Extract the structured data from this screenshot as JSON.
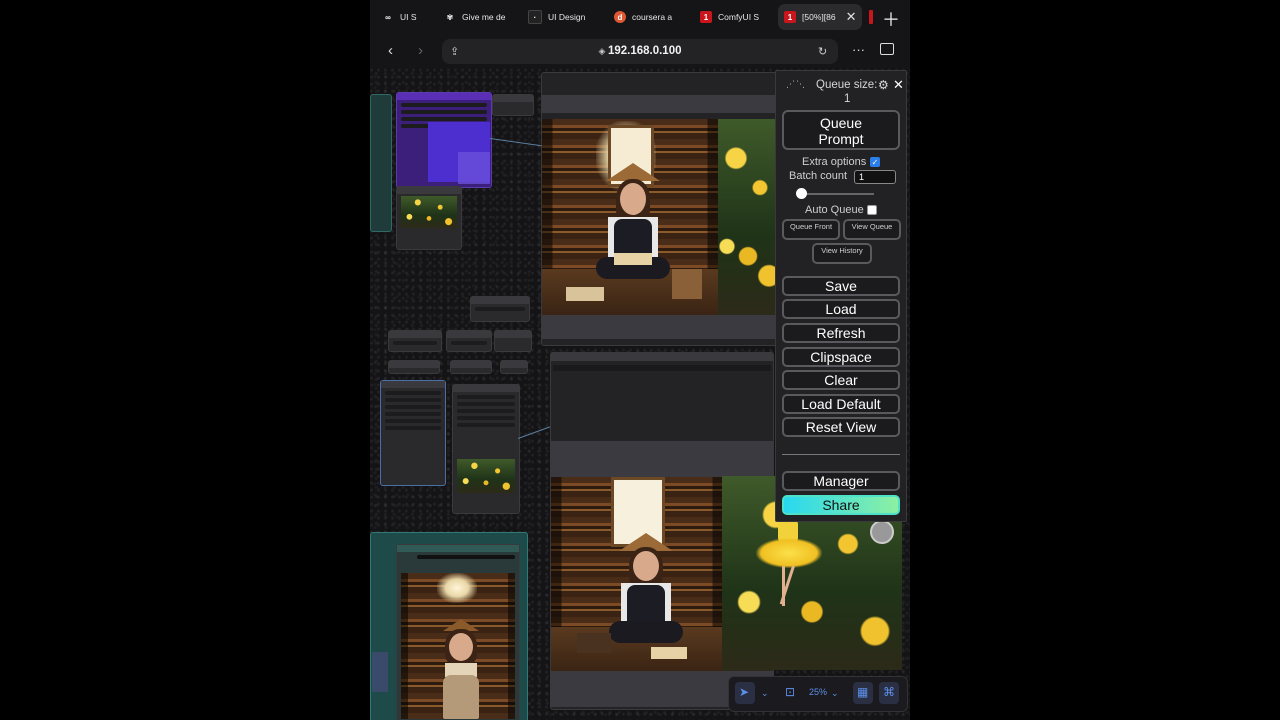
{
  "browser": {
    "tabs": [
      {
        "label": "UI S",
        "icon": "infinity-icon",
        "color": "#ffffff"
      },
      {
        "label": "Give me de",
        "icon": "openai-icon",
        "color": "#ffffff"
      },
      {
        "label": "UI Design",
        "icon": "square-icon",
        "color": "#222222"
      },
      {
        "label": "coursera a",
        "icon": "duckduckgo-icon",
        "color": "#de5833"
      },
      {
        "label": "ComfyUI S",
        "icon": "badge-icon",
        "color": "#c9161c",
        "badge": "1"
      },
      {
        "label": "[50%][86",
        "icon": "badge-icon",
        "color": "#c9161c",
        "badge": "1",
        "active": true
      }
    ],
    "url": "192.168.0.100"
  },
  "panel": {
    "queue_size_label": "Queue size:",
    "queue_size_value": "1",
    "queue_prompt": "Queue Prompt",
    "extra_options_label": "Extra options",
    "extra_options_checked": true,
    "batch_count_label": "Batch count",
    "batch_count_value": "1",
    "auto_queue_label": "Auto Queue",
    "auto_queue_checked": false,
    "queue_front": "Queue Front",
    "view_queue": "View Queue",
    "view_history": "View History",
    "save": "Save",
    "load": "Load",
    "refresh": "Refresh",
    "clipspace": "Clipspace",
    "clear": "Clear",
    "load_default": "Load Default",
    "reset_view": "Reset View",
    "manager": "Manager",
    "share": "Share"
  },
  "toolbar": {
    "zoom": "25%"
  },
  "colors": {
    "accent": "#5d8fe8",
    "share_gradient_start": "#27d8f0",
    "share_gradient_end": "#8df0a2"
  }
}
